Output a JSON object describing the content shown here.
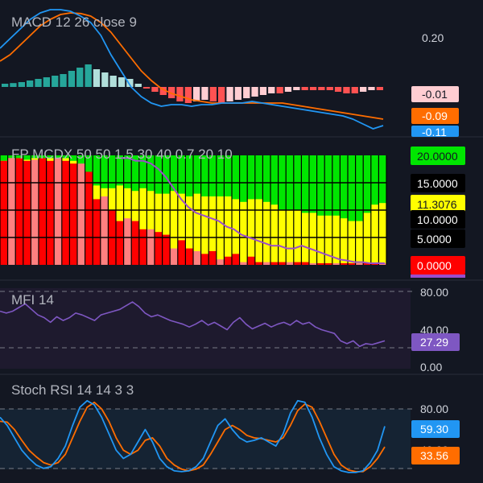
{
  "colors": {
    "background": "#131722",
    "separator": "#2a2e39",
    "text": "#d1d4dc",
    "macd_line": "#2196f3",
    "signal_line": "#ff6d00",
    "hist_pos_strong": "#26a69a",
    "hist_pos_weak": "#b2dfdb",
    "hist_neg_strong": "#ff5252",
    "hist_neg_weak": "#ffcdd2",
    "mcdx_green": "#00e600",
    "mcdx_yellow": "#ffff00",
    "mcdx_red": "#ff0000",
    "mcdx_red_light": "#ff8080",
    "mcdx_line": "#9c4dcc",
    "mfi_line": "#7e57c2",
    "stoch_k": "#2196f3",
    "stoch_d": "#ff6d00"
  },
  "panes": {
    "macd": {
      "title": "MACD 12 26 close 9",
      "axis_label": "0.20"
    },
    "mcdx": {
      "title": "FP MCDX 50 50 1.5 30 40 0.7 20 10"
    },
    "mfi": {
      "title": "MFI 14",
      "axis_labels": [
        "80.00",
        "40.00",
        "0.00"
      ]
    },
    "stoch": {
      "title": "Stoch RSI 14 14 3 3",
      "axis_labels": [
        "80.00",
        "40.00"
      ]
    }
  },
  "badges": {
    "macd_hist": "-0.01",
    "macd_signal": "-0.09",
    "macd_line": "-0.11",
    "mcdx_green_value": "20.0000",
    "mcdx_15": "15.0000",
    "mcdx_yellow_value": "11.3076",
    "mcdx_10": "10.0000",
    "mcdx_5": "5.0000",
    "mcdx_red_value": "0.0000",
    "mfi_value": "27.29",
    "stoch_k_value": "59.30",
    "stoch_d_value": "33.56"
  },
  "chart_data": [
    {
      "type": "line",
      "name": "MACD 12 26 close 9",
      "n_bars": 39,
      "series": [
        {
          "name": "MACD",
          "values": [
            0.12,
            0.15,
            0.18,
            0.21,
            0.23,
            0.24,
            0.24,
            0.235,
            0.22,
            0.2,
            0.16,
            0.1,
            0.05,
            0.0,
            -0.03,
            -0.05,
            -0.06,
            -0.055,
            -0.055,
            -0.06,
            -0.055,
            -0.055,
            -0.05,
            -0.05,
            -0.05,
            -0.045,
            -0.05,
            -0.055,
            -0.06,
            -0.065,
            -0.07,
            -0.075,
            -0.08,
            -0.085,
            -0.09,
            -0.1,
            -0.115,
            -0.13,
            -0.12
          ]
        },
        {
          "name": "Signal",
          "values": [
            0.08,
            0.1,
            0.13,
            0.16,
            0.19,
            0.21,
            0.225,
            0.23,
            0.228,
            0.22,
            0.2,
            0.17,
            0.13,
            0.09,
            0.05,
            0.02,
            -0.005,
            -0.02,
            -0.03,
            -0.04,
            -0.045,
            -0.05,
            -0.05,
            -0.05,
            -0.05,
            -0.05,
            -0.05,
            -0.05,
            -0.05,
            -0.055,
            -0.06,
            -0.065,
            -0.07,
            -0.075,
            -0.08,
            -0.085,
            -0.09,
            -0.095,
            -0.1
          ]
        },
        {
          "name": "Histogram",
          "values": [
            0.01,
            0.012,
            0.015,
            0.02,
            0.025,
            0.03,
            0.035,
            0.04,
            0.05,
            0.06,
            0.07,
            0.055,
            0.045,
            0.035,
            0.03,
            0.025,
            0.01,
            -0.005,
            -0.015,
            -0.025,
            -0.035,
            -0.045,
            -0.05,
            -0.045,
            -0.04,
            -0.045,
            -0.05,
            -0.045,
            -0.04,
            -0.035,
            -0.03,
            -0.025,
            -0.02,
            -0.02,
            -0.015,
            -0.01,
            -0.01,
            -0.01,
            -0.01,
            -0.01,
            -0.015,
            -0.02,
            -0.02,
            -0.015,
            -0.01,
            -0.01
          ]
        }
      ]
    },
    {
      "type": "bar",
      "name": "FP MCDX 50 50 1.5 30 40 0.7 20 10",
      "ylim": [
        0,
        20
      ],
      "series": [
        {
          "name": "red",
          "values": [
            19,
            19.5,
            19.5,
            19,
            19.2,
            19.5,
            19,
            19.5,
            19,
            18.5,
            18.5,
            17,
            12,
            12.5,
            10,
            8,
            8.5,
            8,
            6.5,
            6.5,
            6,
            5.5,
            3,
            4.5,
            3,
            2.5,
            2,
            2.5,
            1,
            1.5,
            2,
            0.5,
            1.5,
            0.5,
            0.5,
            0.5,
            0.5,
            0.5,
            0.5,
            0.5,
            0.3,
            0.3,
            0.3,
            0.3,
            0.3,
            0.3,
            0.3,
            0.3,
            0.3,
            0.3
          ]
        },
        {
          "name": "yellow",
          "values": [
            19,
            19.5,
            19.5,
            19.2,
            19.2,
            19.5,
            19.3,
            19.5,
            19.5,
            19.5,
            19.3,
            19,
            16,
            15,
            14.5,
            14,
            15,
            14,
            14.5,
            14,
            13.5,
            14,
            13.5,
            13,
            13,
            13,
            13.5,
            13,
            12.5,
            12.5,
            13,
            12.5,
            12.5,
            12.5,
            12.5,
            12.5,
            12,
            11.5,
            12,
            12,
            11.5,
            11,
            10.5,
            10,
            10,
            10,
            9.5,
            9.5,
            9,
            9,
            9,
            9,
            8.5,
            8,
            8,
            9,
            9.5,
            11,
            11.3
          ]
        },
        {
          "name": "line",
          "values": [
            19.5,
            19.5,
            19,
            19,
            18.5,
            17.5,
            16,
            14,
            12,
            10.5,
            9.5,
            9,
            8.5,
            8,
            7,
            6.5,
            5.5,
            5,
            4.5,
            4,
            3.5,
            3.5,
            3,
            3,
            3.5,
            3,
            2.5,
            2,
            1.5,
            1,
            0.8,
            0.5,
            0.5,
            0.3,
            0.3,
            0.3
          ]
        }
      ]
    },
    {
      "type": "line",
      "name": "MFI 14",
      "ylim": [
        0,
        100
      ],
      "series": [
        {
          "name": "MFI",
          "values": [
            62,
            60,
            62,
            66,
            70,
            64,
            58,
            55,
            50,
            56,
            52,
            55,
            60,
            58,
            55,
            52,
            58,
            60,
            62,
            64,
            68,
            72,
            67,
            60,
            56,
            58,
            55,
            52,
            50,
            48,
            45,
            48,
            52,
            47,
            50,
            46,
            42,
            50,
            55,
            48,
            43,
            46,
            49,
            45,
            48,
            50,
            47,
            52,
            48,
            50,
            45,
            42,
            40,
            38,
            30,
            27,
            30,
            24,
            27,
            26,
            28,
            30
          ]
        }
      ]
    },
    {
      "type": "line",
      "name": "Stoch RSI 14 14 3 3",
      "ylim": [
        0,
        100
      ],
      "series": [
        {
          "name": "K",
          "values": [
            70,
            60,
            45,
            30,
            20,
            12,
            8,
            10,
            20,
            35,
            60,
            82,
            90,
            85,
            70,
            50,
            30,
            20,
            25,
            40,
            55,
            40,
            20,
            10,
            5,
            4,
            5,
            10,
            20,
            40,
            60,
            68,
            55,
            45,
            40,
            42,
            45,
            40,
            35,
            50,
            75,
            90,
            88,
            70,
            45,
            25,
            10,
            5,
            3,
            3,
            5,
            15,
            30,
            59
          ]
        },
        {
          "name": "D",
          "values": [
            65,
            64,
            55,
            42,
            30,
            22,
            15,
            12,
            15,
            25,
            45,
            65,
            82,
            88,
            80,
            65,
            45,
            30,
            25,
            30,
            42,
            45,
            35,
            20,
            12,
            7,
            5,
            7,
            12,
            25,
            40,
            55,
            60,
            55,
            48,
            45,
            44,
            42,
            40,
            45,
            60,
            78,
            86,
            82,
            65,
            45,
            25,
            12,
            6,
            4,
            4,
            10,
            20,
            34
          ]
        }
      ]
    }
  ]
}
